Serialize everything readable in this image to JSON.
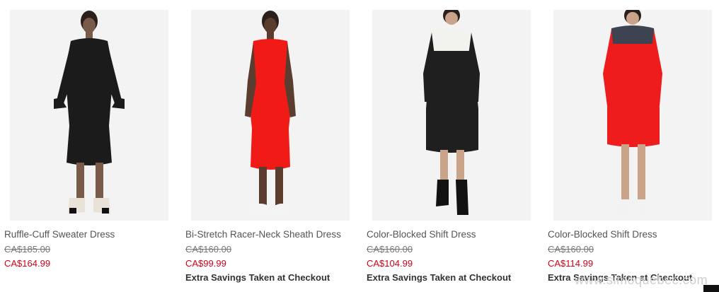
{
  "products": [
    {
      "name": "Ruffle-Cuff Sweater Dress",
      "original_price": "CA$185.00",
      "sale_price": "CA$164.99",
      "promo": "",
      "dress_color": "#1b1b1b",
      "shoe_color": "#e9e2d8"
    },
    {
      "name": "Bi-Stretch Racer-Neck Sheath Dress",
      "original_price": "CA$160.00",
      "sale_price": "CA$99.99",
      "promo": "Extra Savings Taken at Checkout",
      "dress_color": "#f01b16",
      "shoe_color": "#f4f4f4"
    },
    {
      "name": "Color-Blocked Shift Dress",
      "original_price": "CA$160.00",
      "sale_price": "CA$104.99",
      "promo": "Extra Savings Taken at Checkout",
      "dress_color": "#1f1f1f",
      "shoe_color": "#121212"
    },
    {
      "name": "Color-Blocked Shift Dress",
      "original_price": "CA$160.00",
      "sale_price": "CA$114.99",
      "promo": "Extra Savings Taken at Checkout",
      "dress_color": "#ee1c1c",
      "shoe_color": "#f2f2f2"
    }
  ],
  "watermark": "www.simoquebec.com",
  "colors": {
    "sale": "#d0011b",
    "photo_background": "#f3f3f3",
    "skin": "#7a5a49",
    "hair": "#2a1f1a"
  }
}
